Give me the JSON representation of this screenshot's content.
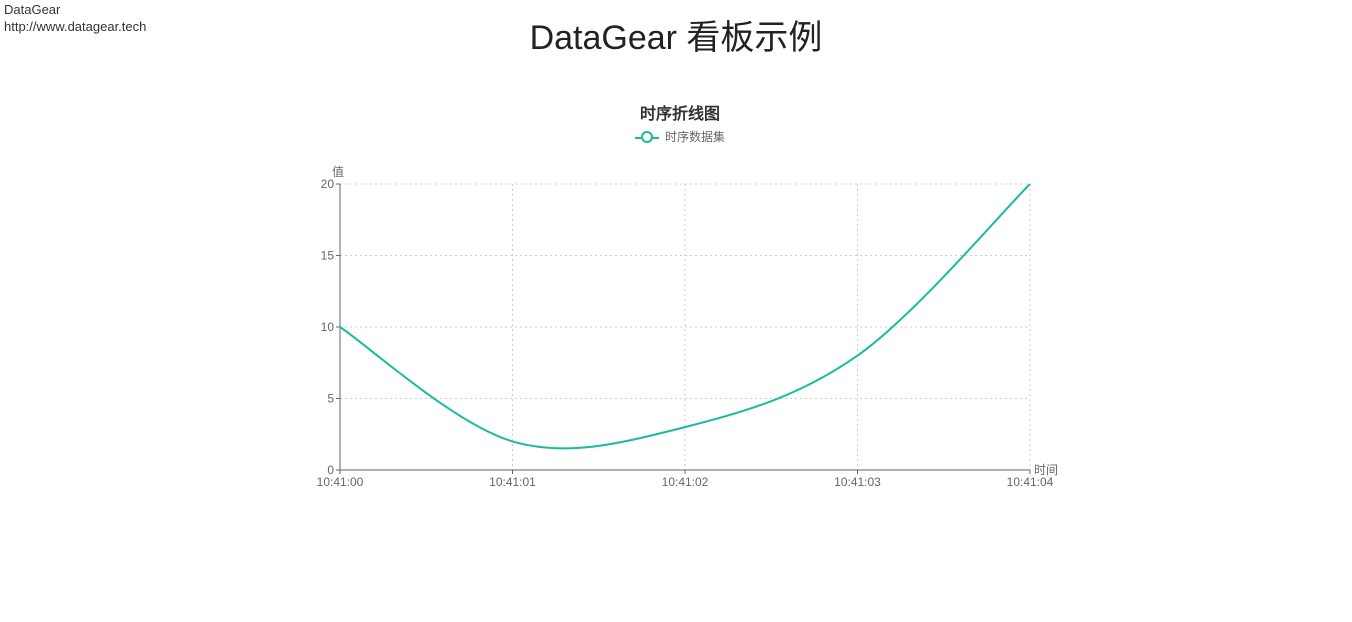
{
  "brand": {
    "name": "DataGear",
    "url": "http://www.datagear.tech"
  },
  "page_title": "DataGear 看板示例",
  "chart_data": {
    "type": "line",
    "title": "时序折线图",
    "legend": "时序数据集",
    "xlabel": "时间",
    "ylabel": "值",
    "series_color": "#1abc9c",
    "x": [
      "10:41:00",
      "10:41:01",
      "10:41:02",
      "10:41:03",
      "10:41:04"
    ],
    "values": [
      10,
      2,
      3,
      8,
      20
    ],
    "y_ticks": [
      0,
      5,
      10,
      15,
      20
    ],
    "ylim": [
      0,
      20
    ]
  }
}
